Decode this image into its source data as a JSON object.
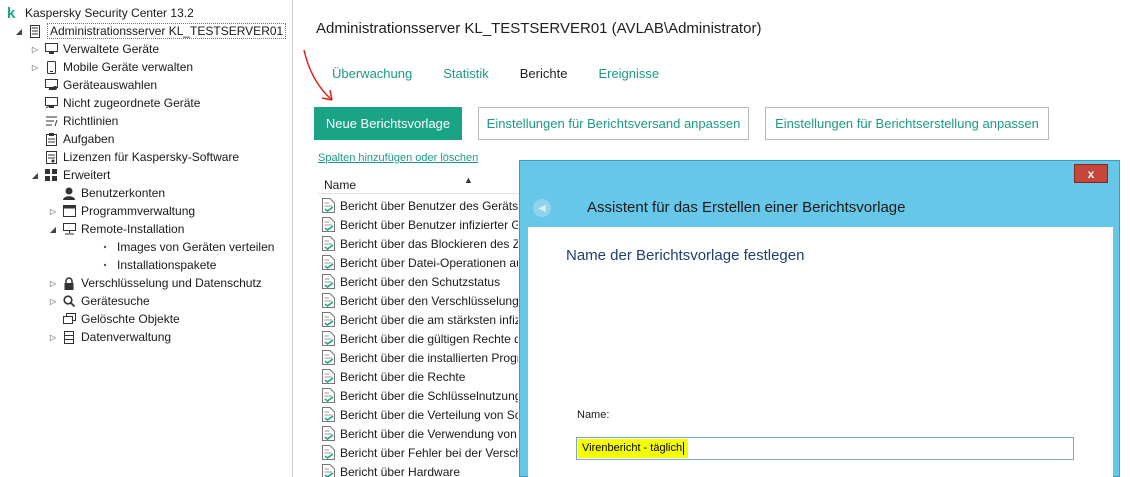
{
  "app": {
    "title": "Kaspersky Security Center 13.2",
    "logo_letter": "k",
    "brand_color": "#1aa385"
  },
  "tree": {
    "server": "Administrationsserver KL_TESTSERVER01",
    "items": [
      {
        "label": "Verwaltete Geräte",
        "icon": "devices-icon",
        "expand": "▷"
      },
      {
        "label": "Mobile Geräte verwalten",
        "icon": "mobile-icon",
        "expand": "▷"
      },
      {
        "label": "Geräteauswahlen",
        "icon": "device-selection-icon",
        "expand": ""
      },
      {
        "label": "Nicht zugeordnete Geräte",
        "icon": "unassigned-devices-icon",
        "expand": ""
      },
      {
        "label": "Richtlinien",
        "icon": "policies-icon",
        "expand": ""
      },
      {
        "label": "Aufgaben",
        "icon": "tasks-icon",
        "expand": ""
      },
      {
        "label": "Lizenzen für Kaspersky-Software",
        "icon": "licenses-icon",
        "expand": ""
      },
      {
        "label": "Erweitert",
        "icon": "advanced-icon",
        "expand": "◢"
      }
    ],
    "advanced": [
      {
        "label": "Benutzerkonten",
        "icon": "user-accounts-icon",
        "expand": ""
      },
      {
        "label": "Programmverwaltung",
        "icon": "app-management-icon",
        "expand": "▷"
      },
      {
        "label": "Remote-Installation",
        "icon": "remote-install-icon",
        "expand": "◢"
      },
      {
        "label": "Images von Geräten verteilen",
        "icon": "bullet",
        "expand": ""
      },
      {
        "label": "Installationspakete",
        "icon": "bullet",
        "expand": ""
      },
      {
        "label": "Verschlüsselung und Datenschutz",
        "icon": "lock-icon",
        "expand": "▷"
      },
      {
        "label": "Gerätesuche",
        "icon": "search-icon",
        "expand": "▷"
      },
      {
        "label": "Gelöschte Objekte",
        "icon": "deleted-objects-icon",
        "expand": ""
      },
      {
        "label": "Datenverwaltung",
        "icon": "data-storage-icon",
        "expand": "▷"
      }
    ]
  },
  "main": {
    "title": "Administrationsserver KL_TESTSERVER01 (AVLAB\\Administrator)",
    "tabs": [
      {
        "label": "Überwachung",
        "active": false
      },
      {
        "label": "Statistik",
        "active": false
      },
      {
        "label": "Berichte",
        "active": true
      },
      {
        "label": "Ereignisse",
        "active": false
      }
    ],
    "buttons": {
      "new_template": "Neue Berichtsvorlage",
      "delivery_settings": "Einstellungen für Berichtsversand anpassen",
      "generation_settings": "Einstellungen für Berichtserstellung anpassen"
    },
    "columns_link": "Spalten hinzufügen oder löschen",
    "list": {
      "header": "Name",
      "rows": [
        "Bericht über Benutzer des Geräts",
        "Bericht über Benutzer infizierter Geräte",
        "Bericht über das Blockieren des Zugriffs",
        "Bericht über Datei-Operationen auf Geräten",
        "Bericht über den Schutzstatus",
        "Bericht über den Verschlüsselungsstatus",
        "Bericht über die am stärksten infizierten Geräte",
        "Bericht über die gültigen Rechte der Benutzer",
        "Bericht über die installierten Programme",
        "Bericht über die Rechte",
        "Bericht über die Schlüsselnutzung",
        "Bericht über die Verteilung von Schlüsseln",
        "Bericht über die Verwendung von Lizenzen",
        "Bericht über Fehler bei der Verschlüsselung",
        "Bericht über Hardware"
      ]
    }
  },
  "wizard": {
    "title": "Assistent für das Erstellen einer Berichtsvorlage",
    "close": "x",
    "heading": "Name der Berichtsvorlage festlegen",
    "name_label": "Name:",
    "name_value": "Virenbericht - täglich",
    "highlight_color": "#f6ff00"
  },
  "annotation": {
    "arrow_color": "#e0221b"
  }
}
